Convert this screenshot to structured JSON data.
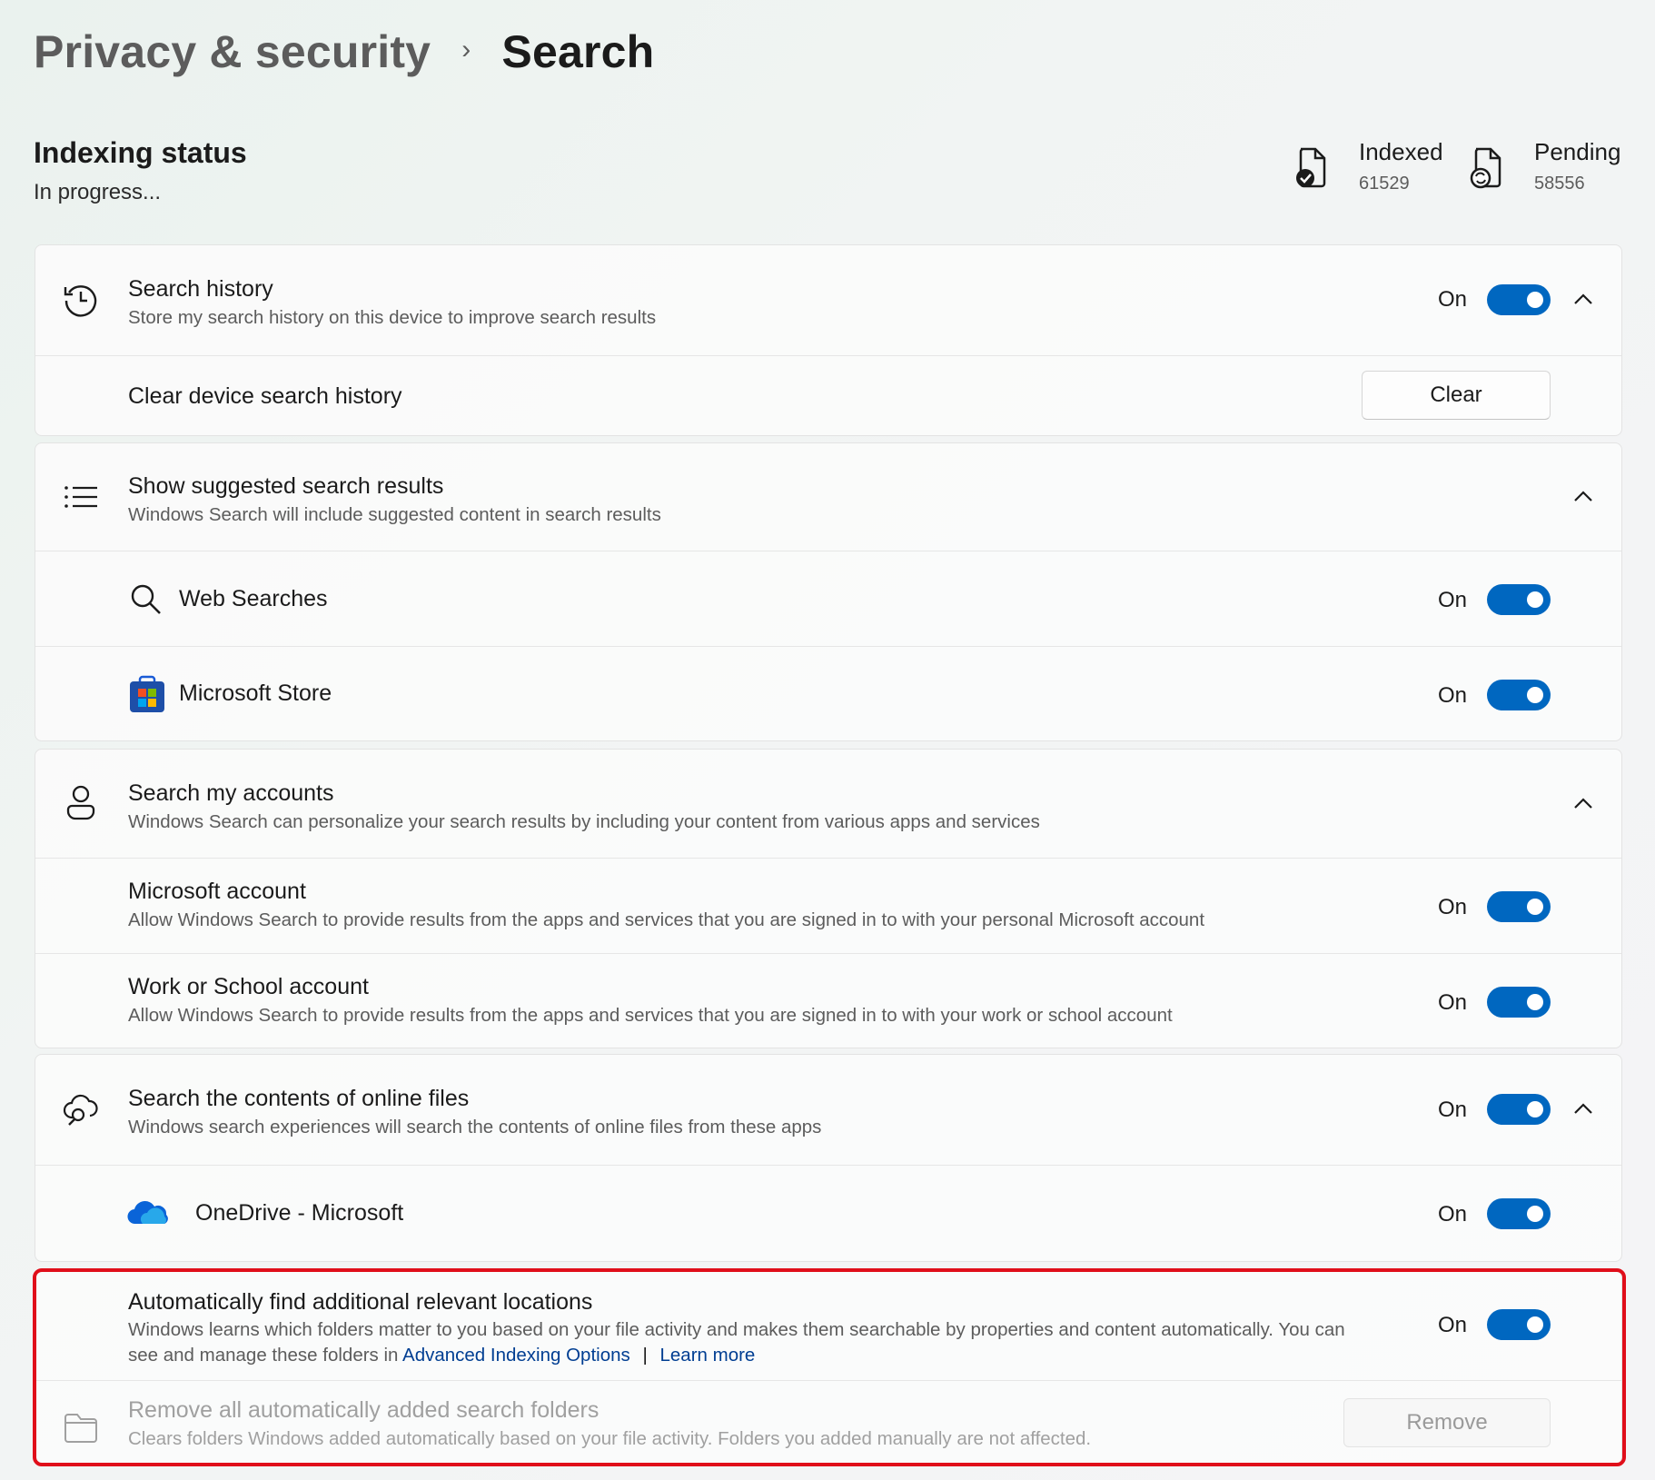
{
  "breadcrumb": {
    "parent": "Privacy & security",
    "separator": "›",
    "current": "Search"
  },
  "indexing": {
    "title": "Indexing status",
    "status": "In progress...",
    "indexed": {
      "label": "Indexed",
      "value": "61529"
    },
    "pending": {
      "label": "Pending",
      "value": "58556"
    }
  },
  "search_history": {
    "title": "Search history",
    "description": "Store my search history on this device to improve search results",
    "state": "On",
    "clear_row_title": "Clear device search history",
    "clear_button": "Clear"
  },
  "suggested": {
    "title": "Show suggested search results",
    "description": "Windows Search will include suggested content in search results",
    "web_searches": {
      "title": "Web Searches",
      "state": "On"
    },
    "microsoft_store": {
      "title": "Microsoft Store",
      "state": "On"
    }
  },
  "accounts": {
    "title": "Search my accounts",
    "description": "Windows Search can personalize your search results by including your content from various apps and services",
    "microsoft_account": {
      "title": "Microsoft account",
      "description": "Allow Windows Search to provide results from the apps and services that you are signed in to with your personal Microsoft account",
      "state": "On"
    },
    "work_account": {
      "title": "Work or School account",
      "description": "Allow Windows Search to provide results from the apps and services that you are signed in to with your work or school account",
      "state": "On"
    }
  },
  "online_files": {
    "title": "Search the contents of online files",
    "description": "Windows search experiences will search the contents of online files from these apps",
    "state": "On",
    "onedrive": {
      "title": "OneDrive - Microsoft",
      "state": "On"
    }
  },
  "auto_locations": {
    "title": "Automatically find additional relevant locations",
    "description_line1": "Windows learns which folders matter to you based on your file activity and makes them searchable by properties and content automatically. You can",
    "description_line2": "see and manage these folders in",
    "link_advanced": "Advanced Indexing Options",
    "link_sep": "|",
    "link_learn": "Learn more",
    "state": "On"
  },
  "remove_folders": {
    "title": "Remove all automatically added search folders",
    "description": "Clears folders Windows added automatically based on your file activity. Folders you added manually are not affected.",
    "button": "Remove"
  },
  "colors": {
    "accent": "#0067c0",
    "highlight": "#e00e1a",
    "link": "#003e92"
  }
}
